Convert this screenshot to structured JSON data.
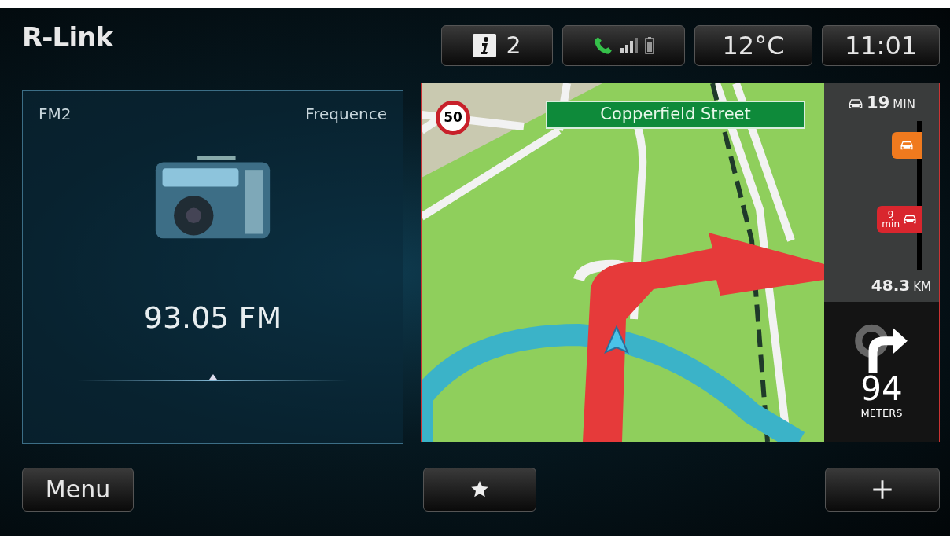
{
  "header": {
    "logo": "R-Link",
    "status": [
      {
        "kind": "info",
        "text": "2"
      },
      {
        "kind": "phone"
      },
      {
        "kind": "text",
        "text": "12°C"
      },
      {
        "kind": "text",
        "text": "11:01"
      }
    ]
  },
  "radio": {
    "band": "FM2",
    "mode": "Frequence",
    "frequency": "93.05 FM",
    "level": 0.5
  },
  "map": {
    "speed_limit": "50",
    "street": "Copperfield Street",
    "eta": {
      "value": "19",
      "unit": "MIN"
    },
    "traffic": [
      {
        "kind": "icon",
        "color": "#f07a1e"
      },
      {
        "kind": "delay",
        "color": "#d9262e",
        "value": "9",
        "unit": "min"
      }
    ],
    "distance": {
      "value": "48.3",
      "unit": "KM"
    },
    "next_turn": {
      "value": "94",
      "unit": "METERS"
    }
  },
  "footer": {
    "buttons": [
      {
        "kind": "text",
        "text": "Menu"
      },
      {
        "kind": "star"
      },
      {
        "kind": "plus"
      }
    ]
  }
}
